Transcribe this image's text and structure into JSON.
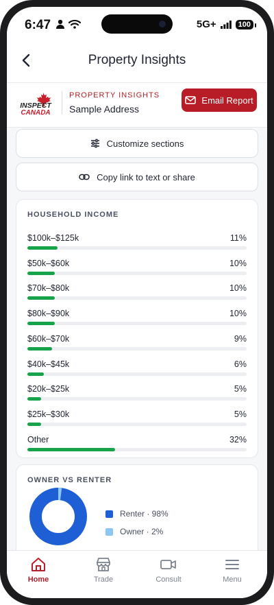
{
  "status_bar": {
    "time": "6:47",
    "network": "5G+",
    "battery": "100"
  },
  "header": {
    "title": "Property Insights"
  },
  "brand": {
    "logo_text_top": "INSPECT",
    "logo_text_bottom": "CANADA",
    "kicker": "PROPERTY INSIGHTS",
    "address": "Sample Address",
    "email_button": "Email Report"
  },
  "actions": {
    "customize": "Customize sections",
    "copy_link": "Copy link to text or share"
  },
  "household_income": {
    "title": "HOUSEHOLD INCOME",
    "rows": [
      {
        "label": "$100k–$125k",
        "pct_text": "11%",
        "value": 11
      },
      {
        "label": "$50k–$60k",
        "pct_text": "10%",
        "value": 10
      },
      {
        "label": "$70k–$80k",
        "pct_text": "10%",
        "value": 10
      },
      {
        "label": "$80k–$90k",
        "pct_text": "10%",
        "value": 10
      },
      {
        "label": "$60k–$70k",
        "pct_text": "9%",
        "value": 9
      },
      {
        "label": "$40k–$45k",
        "pct_text": "6%",
        "value": 6
      },
      {
        "label": "$20k–$25k",
        "pct_text": "5%",
        "value": 5
      },
      {
        "label": "$25k–$30k",
        "pct_text": "5%",
        "value": 5
      },
      {
        "label": "Other",
        "pct_text": "32%",
        "value": 32
      }
    ]
  },
  "owner_vs_renter": {
    "title": "OWNER VS RENTER",
    "renter_label": "Renter · 98%",
    "owner_label": "Owner · 2%",
    "renter_value": 98,
    "owner_value": 2
  },
  "tabs": [
    {
      "label": "Home",
      "icon": "home-icon"
    },
    {
      "label": "Trade",
      "icon": "store-icon"
    },
    {
      "label": "Consult",
      "icon": "video-icon"
    },
    {
      "label": "Menu",
      "icon": "menu-icon"
    }
  ],
  "colors": {
    "accent_red": "#b81d27",
    "bar_green": "#16a34a",
    "renter_blue": "#1e5fd6",
    "owner_light_blue": "#8cc7f2"
  }
}
